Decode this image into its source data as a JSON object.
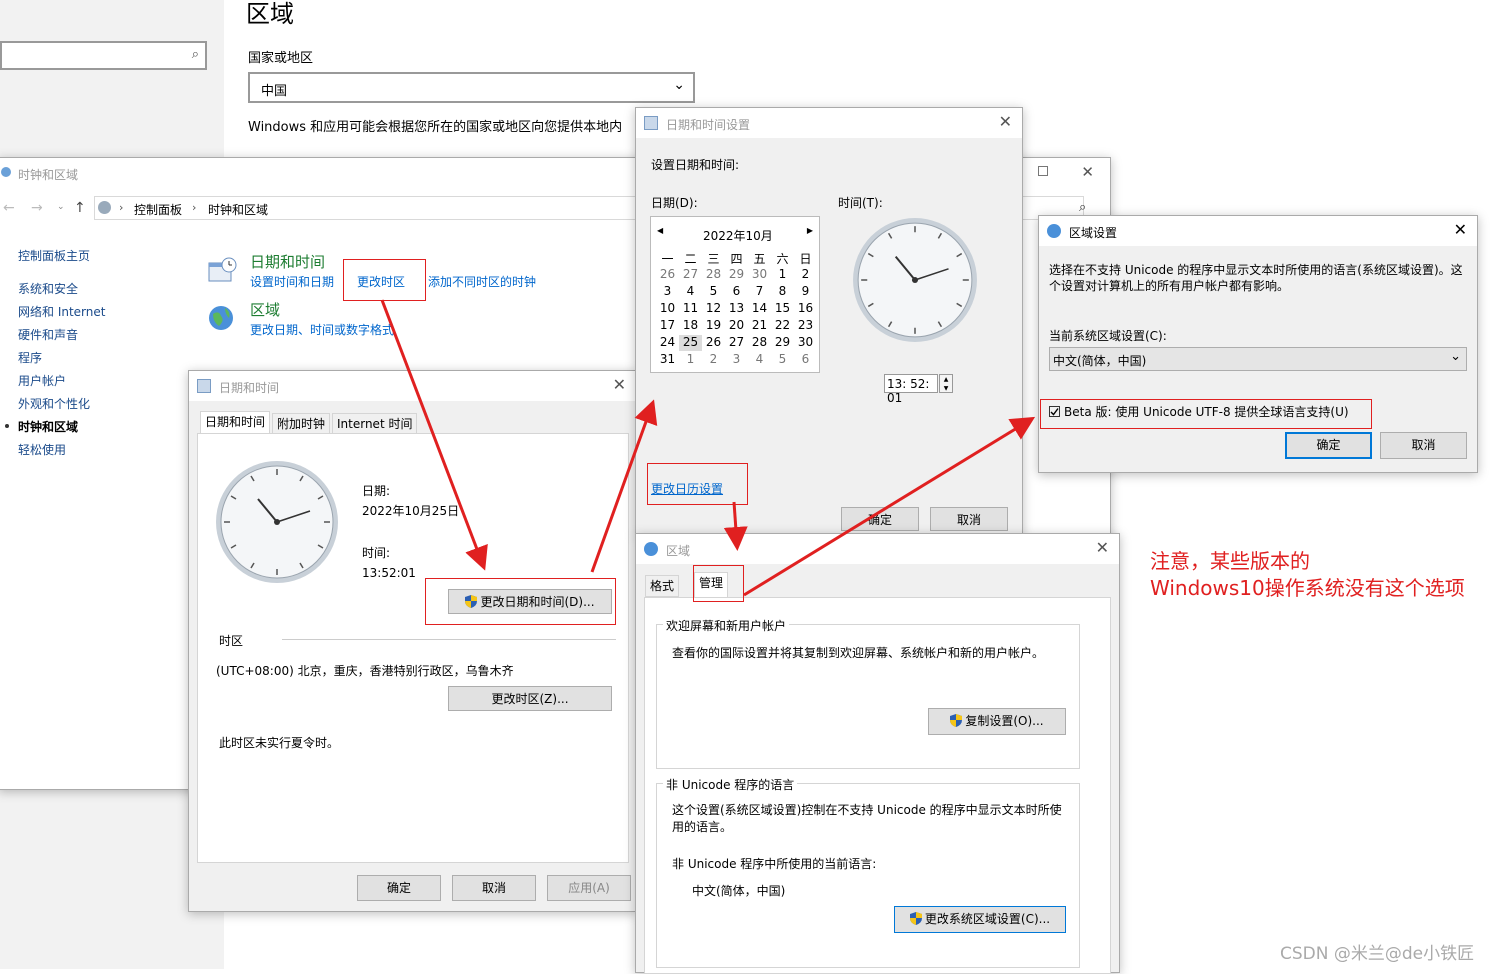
{
  "settings_page": {
    "title": "区域",
    "country_label": "国家或地区",
    "country_value": "中国",
    "description": "Windows 和应用可能会根据您所在的国家或地区向您提供本地内"
  },
  "control_panel": {
    "title": "时钟和区域",
    "breadcrumb": [
      "控制面板",
      "时钟和区域"
    ],
    "sidebar": [
      "控制面板主页",
      "系统和安全",
      "网络和 Internet",
      "硬件和声音",
      "程序",
      "用户帐户",
      "外观和个性化",
      "时钟和区域",
      "轻松使用"
    ],
    "datetime_heading": "日期和时间",
    "datetime_links": [
      "设置时间和日期",
      "更改时区",
      "添加不同时区的时钟"
    ],
    "region_heading": "区域",
    "region_link": "更改日期、时间或数字格式"
  },
  "datetime_dialog": {
    "title": "日期和时间",
    "tabs": [
      "日期和时间",
      "附加时钟",
      "Internet 时间"
    ],
    "date_label": "日期:",
    "date_value": "2022年10月25日",
    "time_label": "时间:",
    "time_value": "13:52:01",
    "change_button": "更改日期和时间(D)...",
    "timezone_label": "时区",
    "timezone_value": "(UTC+08:00) 北京，重庆，香港特别行政区，乌鲁木齐",
    "change_tz_button": "更改时区(Z)...",
    "dst_note": "此时区未实行夏令时。",
    "ok": "确定",
    "cancel": "取消",
    "apply": "应用(A)"
  },
  "datetime_settings": {
    "title": "日期和时间设置",
    "heading": "设置日期和时间:",
    "date_label": "日期(D):",
    "time_label": "时间(T):",
    "month": "2022年10月",
    "weekdays": [
      "一",
      "二",
      "三",
      "四",
      "五",
      "六",
      "日"
    ],
    "days": [
      "26",
      "27",
      "28",
      "29",
      "30",
      "1",
      "2",
      "3",
      "4",
      "5",
      "6",
      "7",
      "8",
      "9",
      "10",
      "11",
      "12",
      "13",
      "14",
      "15",
      "16",
      "17",
      "18",
      "19",
      "20",
      "21",
      "22",
      "23",
      "24",
      "25",
      "26",
      "27",
      "28",
      "29",
      "30",
      "31",
      "1",
      "2",
      "3",
      "4",
      "5",
      "6"
    ],
    "selected_day": "25",
    "time_value": "13: 52: 01",
    "calendar_link": "更改日历设置",
    "ok": "确定",
    "cancel": "取消"
  },
  "region_dialog": {
    "title": "区域",
    "tabs": [
      "格式",
      "管理"
    ],
    "welcome_group": "欢迎屏幕和新用户帐户",
    "welcome_text": "查看你的国际设置并将其复制到欢迎屏幕、系统帐户和新的用户帐户。",
    "copy_button": "复制设置(O)...",
    "nonunicode_group": "非 Unicode 程序的语言",
    "nonunicode_text": "这个设置(系统区域设置)控制在不支持 Unicode 的程序中显示文本时所使用的语言。",
    "current_label": "非 Unicode 程序中所使用的当前语言:",
    "current_value": "中文(简体，中国)",
    "change_locale_button": "更改系统区域设置(C)..."
  },
  "locale_dialog": {
    "title": "区域设置",
    "description": "选择在不支持 Unicode 的程序中显示文本时所使用的语言(系统区域设置)。这个设置对计算机上的所有用户帐户都有影响。",
    "current_label": "当前系统区域设置(C):",
    "current_value": "中文(简体，中国)",
    "beta_label": "Beta 版: 使用 Unicode UTF-8 提供全球语言支持(U)",
    "ok": "确定",
    "cancel": "取消"
  },
  "annotation": {
    "line1": "注意，某些版本的",
    "line2": "Windows10操作系统没有这个选项"
  },
  "watermark": "CSDN @米兰@de小铁匠",
  "colors": {
    "link": "#0066cc",
    "annotation": "#e02020",
    "accent": "#0078d7"
  }
}
